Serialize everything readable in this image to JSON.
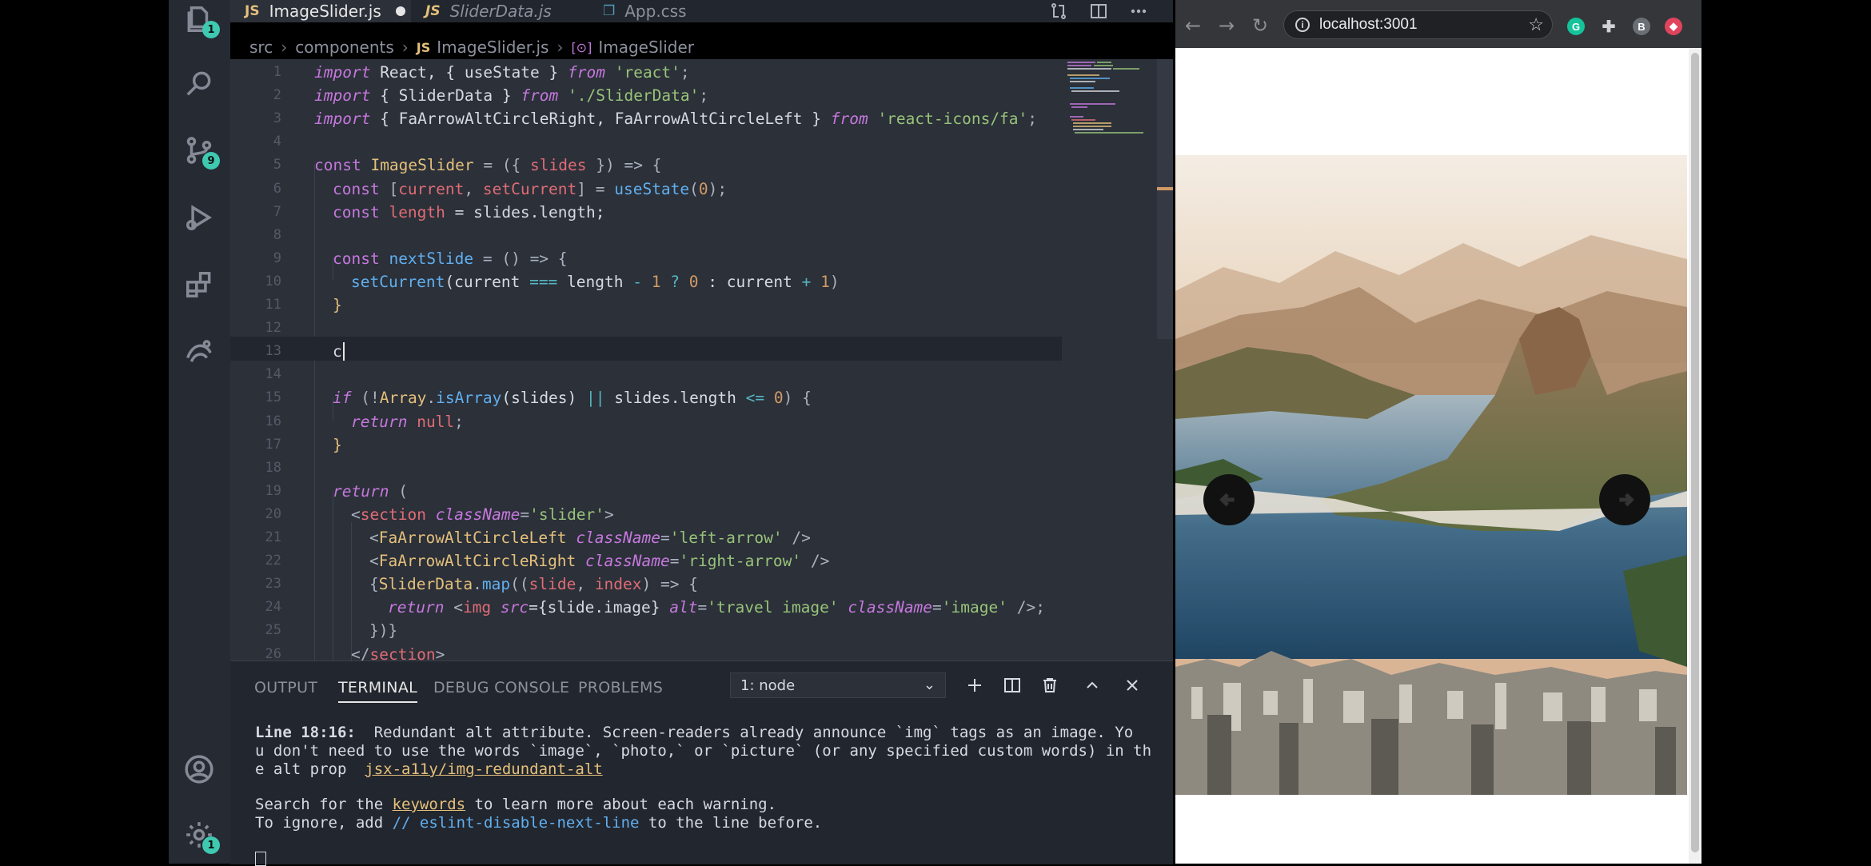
{
  "activity_bar": {
    "explorer_badge": "1",
    "scm_badge": "9",
    "settings_badge": "1"
  },
  "tabs": [
    {
      "type": "JS",
      "label": "ImageSlider.js"
    },
    {
      "type": "JS",
      "label": "SliderData.js"
    },
    {
      "type": "css",
      "label": "App.css"
    }
  ],
  "breadcrumb": {
    "part1": "src",
    "part2": "components",
    "file_type": "JS",
    "file": "ImageSlider.js",
    "symbol": "ImageSlider"
  },
  "code_lines": [
    {
      "n": "1"
    },
    {
      "n": "2"
    },
    {
      "n": "3"
    },
    {
      "n": "4"
    },
    {
      "n": "5"
    },
    {
      "n": "6"
    },
    {
      "n": "7"
    },
    {
      "n": "8"
    },
    {
      "n": "9"
    },
    {
      "n": "10"
    },
    {
      "n": "11"
    },
    {
      "n": "12"
    },
    {
      "n": "13"
    },
    {
      "n": "14"
    },
    {
      "n": "15"
    },
    {
      "n": "16"
    },
    {
      "n": "17"
    },
    {
      "n": "18"
    },
    {
      "n": "19"
    },
    {
      "n": "20"
    },
    {
      "n": "21"
    },
    {
      "n": "22"
    },
    {
      "n": "23"
    },
    {
      "n": "24"
    },
    {
      "n": "25"
    },
    {
      "n": "26"
    }
  ],
  "code": {
    "l1": [
      "import",
      " React, { useState } ",
      "from",
      " ",
      "'react'",
      ";"
    ],
    "l2": [
      "import",
      " { SliderData } ",
      "from",
      " ",
      "'./SliderData'",
      ";"
    ],
    "l3": [
      "import",
      " { FaArrowAltCircleRight, FaArrowAltCircleLeft } ",
      "from",
      " ",
      "'react-icons/fa'",
      ";"
    ],
    "l5": [
      "const",
      " ",
      "ImageSlider",
      " = ({ ",
      "slides",
      " }) => {"
    ],
    "l6": [
      "const",
      " [",
      "current",
      ", ",
      "setCurrent",
      "] = ",
      "useState",
      "(",
      "0",
      ");"
    ],
    "l7": [
      "const",
      " ",
      "length",
      " = slides.length;"
    ],
    "l9": [
      "const",
      " ",
      "nextSlide",
      " = () => {"
    ],
    "l10": [
      "setCurrent",
      "(current ",
      "===",
      " length ",
      "-",
      " ",
      "1",
      " ",
      "?",
      " ",
      "0",
      " : current ",
      "+",
      " ",
      "1",
      ")"
    ],
    "l11": [
      "}"
    ],
    "l13": [
      "c"
    ],
    "l15": [
      "if",
      " (!",
      "Array",
      ".",
      "isArray",
      "(slides) ",
      "||",
      " slides.length ",
      "<=",
      " ",
      "0",
      ") {"
    ],
    "l16": [
      "return",
      " ",
      "null",
      ";"
    ],
    "l17": [
      "}"
    ],
    "l19": [
      "return",
      " ("
    ],
    "l20": [
      "<",
      "section",
      " ",
      "className",
      "=",
      "'slider'",
      ">"
    ],
    "l21": [
      "<",
      "FaArrowAltCircleLeft",
      " ",
      "className",
      "=",
      "'left-arrow'",
      " />"
    ],
    "l22": [
      "<",
      "FaArrowAltCircleRight",
      " ",
      "className",
      "=",
      "'right-arrow'",
      " />"
    ],
    "l23": [
      "{",
      "SliderData",
      ".",
      "map",
      "((",
      "slide",
      ", ",
      "index",
      ") => {"
    ],
    "l24": [
      "return",
      " <",
      "img",
      " ",
      "src",
      "={slide.image} ",
      "alt",
      "=",
      "'travel image'",
      " ",
      "className",
      "=",
      "'image'",
      " />;"
    ],
    "l25": [
      "})}"
    ],
    "l26": [
      "</",
      "section",
      ">"
    ]
  },
  "panel": {
    "tabs": [
      "OUTPUT",
      "TERMINAL",
      "DEBUG CONSOLE",
      "PROBLEMS"
    ],
    "terminal_select": "1: node",
    "line1_label": "Line 18:16:",
    "line1_text": "  Redundant alt attribute. Screen-readers already announce `img` tags as an image. Yo",
    "line2_text": "u don't need to use the words `image`, `photo,` or `picture` (or any specified custom words) in th",
    "line3_prefix": "e alt prop  ",
    "line3_link": "jsx-a11y/img-redundant-alt",
    "line4_prefix": "Search for the ",
    "line4_link": "keywords",
    "line4_suffix": " to learn more about each warning.",
    "line5_prefix": "To ignore, add ",
    "line5_comment": "// eslint-disable-next-line",
    "line5_suffix": " to the line before."
  },
  "browser": {
    "url": "localhost:3001",
    "profile_initial": "B",
    "grammarly": "G"
  }
}
